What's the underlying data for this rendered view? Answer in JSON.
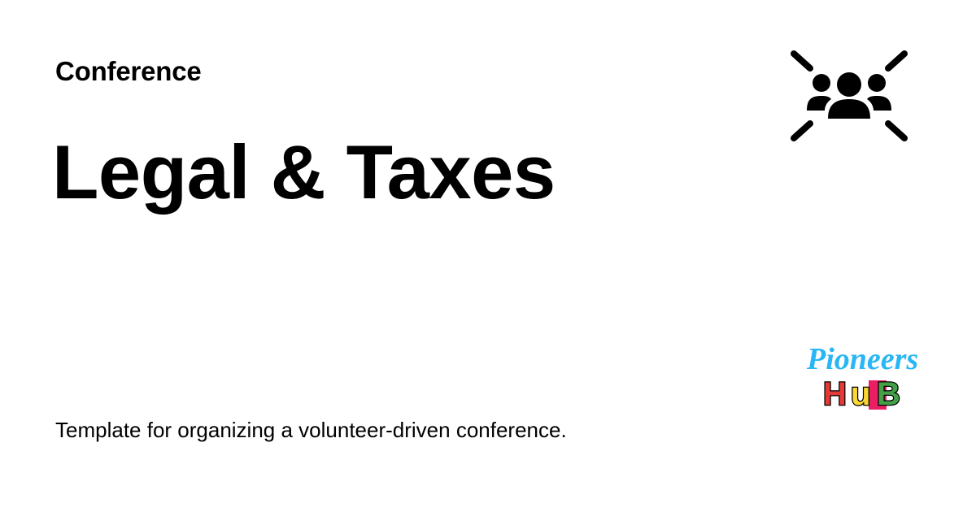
{
  "card": {
    "category": "Conference",
    "title": "Legal & Taxes",
    "description": "Template for organizing a volunteer-driven conference."
  },
  "icons": {
    "topic": "people-group-icon",
    "brand": "pioneers-hub-logo"
  },
  "logo": {
    "line1": "Pioneers",
    "line2": "HUB",
    "colors": {
      "line1": "#29b6f6",
      "h": "#e53935",
      "u": "#fdd835",
      "b": "#43a047",
      "accent_pink": "#e91e63",
      "outline": "#000000"
    }
  }
}
